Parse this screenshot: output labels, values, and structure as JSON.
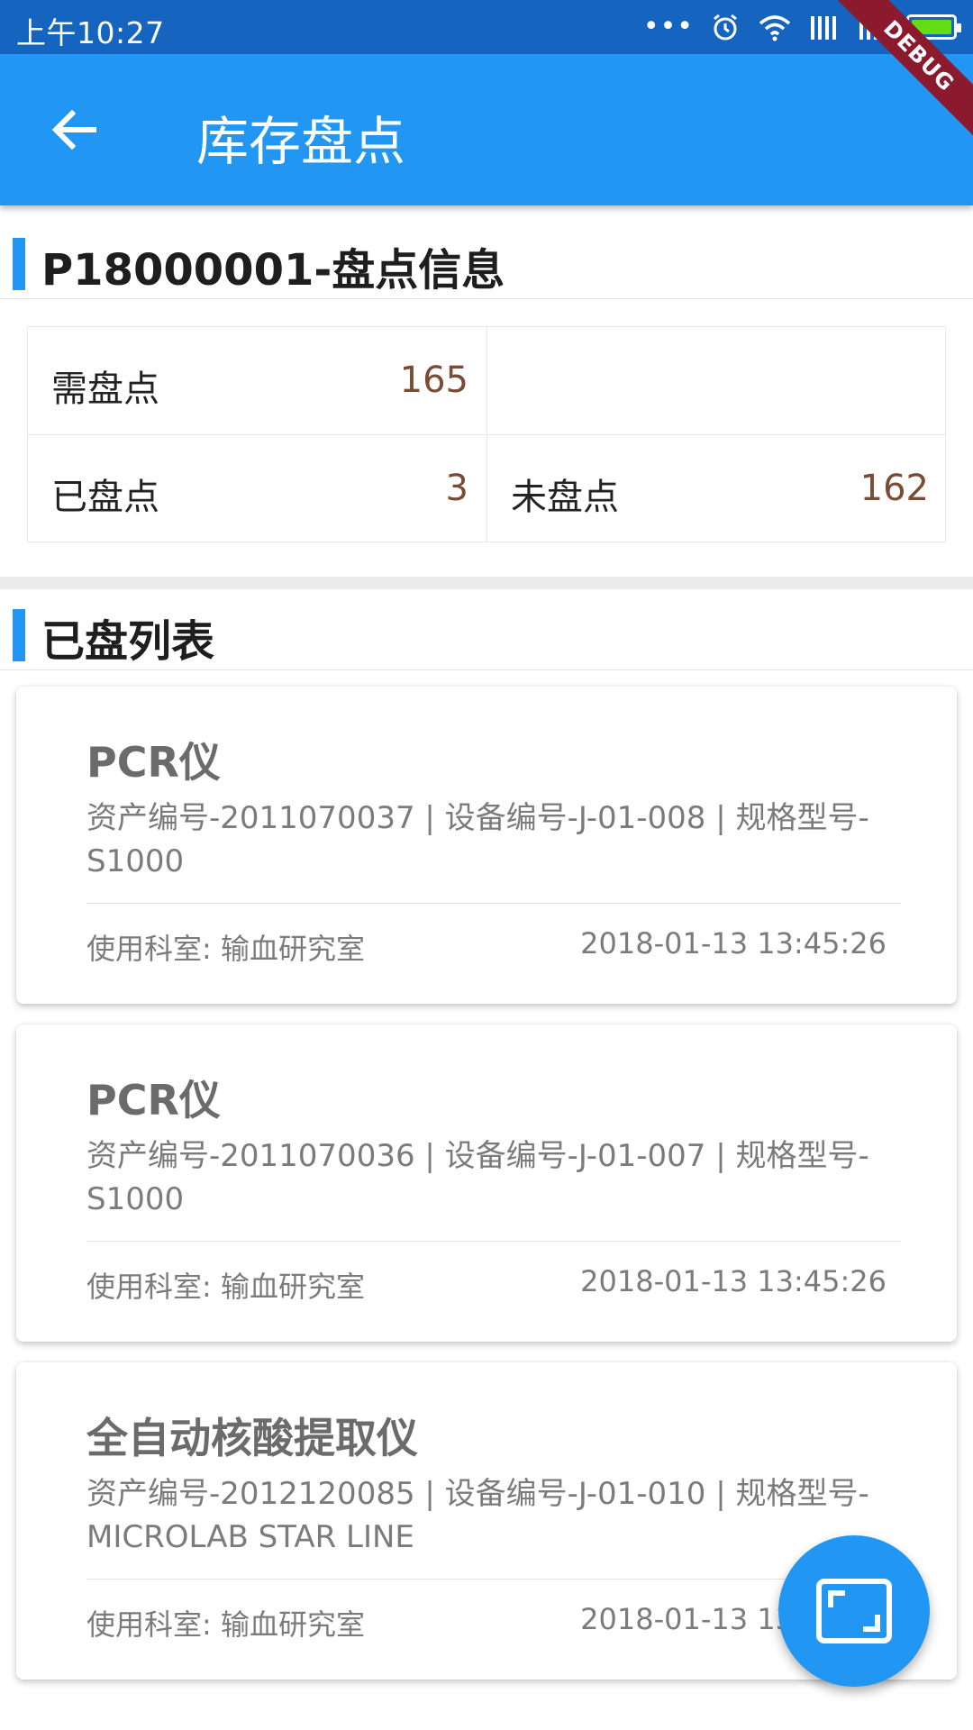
{
  "status_bar": {
    "time": "上午10:27",
    "icons": [
      "more-dots-icon",
      "alarm-icon",
      "wifi-icon",
      "signal-icon",
      "signal-icon",
      "battery-icon"
    ]
  },
  "app_bar": {
    "title": "库存盘点",
    "back_icon": "arrow-back-icon",
    "debug_label": "DEBUG"
  },
  "info_section": {
    "title": "P18000001-盘点信息",
    "stats": {
      "need_label": "需盘点",
      "need_value": "165",
      "done_label": "已盘点",
      "done_value": "3",
      "todo_label": "未盘点",
      "todo_value": "162"
    }
  },
  "list_section": {
    "title": "已盘列表"
  },
  "items": [
    {
      "name": "PCR仪",
      "desc": "资产编号-2011070037 | 设备编号-J-01-008 | 规格型号-S1000",
      "dept": "使用科室: 输血研究室",
      "time": "2018-01-13 13:45:26"
    },
    {
      "name": "PCR仪",
      "desc": "资产编号-2011070036 | 设备编号-J-01-007 | 规格型号-S1000",
      "dept": "使用科室: 输血研究室",
      "time": "2018-01-13 13:45:26"
    },
    {
      "name": "全自动核酸提取仪",
      "desc": "资产编号-2012120085 | 设备编号-J-01-010 | 规格型号-MICROLAB STAR LINE",
      "dept": "使用科室: 输血研究室",
      "time": "2018-01-13 13:45:26"
    }
  ],
  "fab": {
    "icon": "scan-frame-icon"
  },
  "colors": {
    "status_bar": "#1565C0",
    "primary": "#2196F3",
    "value_text": "#7a4b35",
    "debug_ribbon": "#8B1A2E"
  }
}
